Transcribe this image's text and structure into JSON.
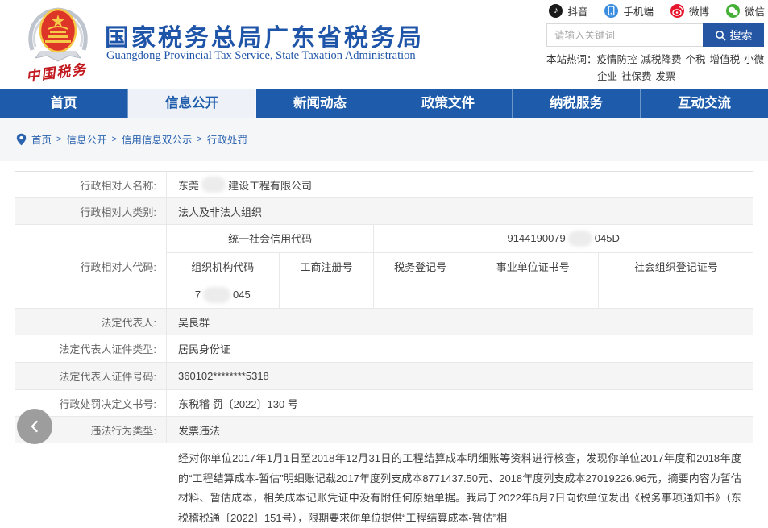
{
  "colors": {
    "nav-blue": "#1e5cab",
    "title-blue": "#1f55a8",
    "seal-red": "#c2191f",
    "button-blue": "#2456a4",
    "band-gray": "#f5f6f8",
    "row-gray": "#f5f5f5",
    "link-blue": "#2b63af"
  },
  "header": {
    "title": "国家税务总局广东省税务局",
    "subtitle": "Guangdong Provincial Tax Service, State Taxation Administration",
    "seal_text": "中国税务",
    "social": [
      {
        "label": "抖音",
        "color": "#1a1a1a"
      },
      {
        "label": "手机端",
        "color": "#3b8de0"
      },
      {
        "label": "微博",
        "color": "#e6162d"
      },
      {
        "label": "微信",
        "color": "#44b035"
      }
    ],
    "search": {
      "placeholder": "请输入关键词",
      "button": "搜索"
    },
    "hot": {
      "label": "本站热词：",
      "words": [
        "疫情防控",
        "减税降费",
        "个税",
        "增值税",
        "小微企业",
        "社保费",
        "发票"
      ]
    }
  },
  "nav": {
    "items": [
      {
        "label": "首页",
        "active": false
      },
      {
        "label": "信息公开",
        "active": true
      },
      {
        "label": "新闻动态",
        "active": false
      },
      {
        "label": "政策文件",
        "active": false
      },
      {
        "label": "纳税服务",
        "active": false
      },
      {
        "label": "互动交流",
        "active": false
      }
    ]
  },
  "breadcrumb": {
    "separator": ">",
    "items": [
      "首页",
      "信息公开",
      "信用信息双公示",
      "行政处罚"
    ]
  },
  "table": {
    "name": {
      "label": "行政相对人名称:",
      "prefix": "东莞",
      "suffix": "建设工程有限公司",
      "redacted": true
    },
    "category": {
      "label": "行政相对人类别:",
      "value": "法人及非法人组织"
    },
    "code": {
      "label": "行政相对人代码:",
      "credit_label": "统一社会信用代码",
      "credit_prefix": "9144190079",
      "credit_suffix": "045D",
      "redacted": true,
      "headers": [
        "组织机构代码",
        "工商注册号",
        "税务登记号",
        "事业单位证书号",
        "社会组织登记证号"
      ],
      "org_prefix": "7",
      "org_suffix": "045"
    },
    "legal_rep": {
      "label": "法定代表人:",
      "value": "吴良群"
    },
    "id_type": {
      "label": "法定代表人证件类型:",
      "value": "居民身份证"
    },
    "id_number": {
      "label": "法定代表人证件号码:",
      "value": "360102********5318"
    },
    "doc_no": {
      "label": "行政处罚决定文书号:",
      "value": "东税稽 罚〔2022〕130 号"
    },
    "violation": {
      "label": "违法行为类型:",
      "value": "发票违法"
    },
    "detail": {
      "label": "",
      "value": "经对你单位2017年1月1日至2018年12月31日的工程结算成本明细账等资料进行核查，发现你单位2017年度和2018年度的“工程结算成本-暂估”明细账记载2017年度列支成本8771437.50元、2018年度列支成本27019226.96元，摘要内容为暂估材料、暂估成本，相关成本记账凭证中没有附任何原始单据。我局于2022年6月7日向你单位发出《税务事项通知书》（东税稽税通〔2022〕151号），限期要求你单位提供“工程结算成本-暂估”相"
    }
  }
}
